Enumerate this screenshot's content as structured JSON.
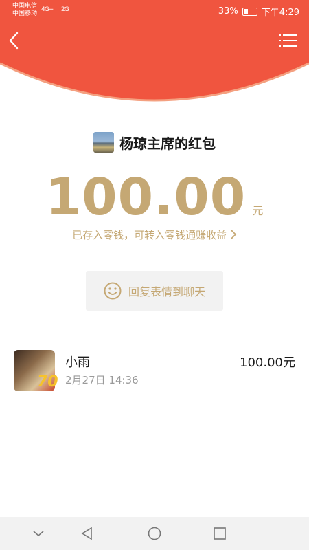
{
  "status_bar": {
    "carrier_1": "中国电信",
    "carrier_2": "中国移动",
    "net_1": "4G+",
    "net_2": "2G",
    "battery": "33%",
    "battery_level": 0.33,
    "time": "下午4:29"
  },
  "colors": {
    "header_red": "#f0553f",
    "gold": "#c5a874",
    "gold_accent": "#f6c22b"
  },
  "toolbar": {
    "back_icon": "chevron-left-icon",
    "menu_icon": "list-icon"
  },
  "packet": {
    "sender_avatar": "landscape-photo",
    "title": "杨琼主席的红包",
    "amount": "100.00",
    "unit": "元",
    "saved_note": "已存入零钱，可转入零钱通赚收益",
    "reply_label": "回复表情到聊天",
    "reply_icon": "smiley-icon"
  },
  "records": [
    {
      "name": "小雨",
      "time": "2月27日  14:36",
      "amount": "100.00元",
      "avatar_badge": "70"
    }
  ],
  "nav_bar": {
    "icons": [
      "chevron-down-icon",
      "back-triangle-icon",
      "home-circle-icon",
      "recents-square-icon"
    ]
  }
}
